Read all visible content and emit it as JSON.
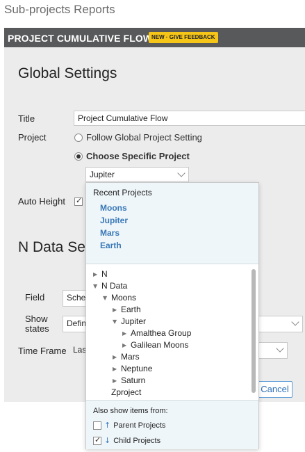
{
  "page": {
    "heading": "Sub-projects Reports"
  },
  "panel": {
    "title": "PROJECT CUMULATIVE FLOW",
    "badge": "NEW · GIVE FEEDBACK"
  },
  "global_settings": {
    "section_title": "Global Settings",
    "title_label": "Title",
    "title_value": "Project Cumulative Flow",
    "project_label": "Project",
    "radio_follow": "Follow Global Project Setting",
    "radio_choose": "Choose Specific Project",
    "selected_project": "Jupiter",
    "auto_height_label": "Auto Height",
    "auto_height_checked": true
  },
  "n_data": {
    "section_title": "N Data Set",
    "field_label": "Field",
    "field_value": "Sched",
    "show_states_label_line1": "Show",
    "show_states_label_line2": "states",
    "show_states_value": "Defin",
    "time_frame_label": "Time Frame",
    "time_frame_value": "Las"
  },
  "buttons": {
    "cancel": "Cancel"
  },
  "picker": {
    "recent_title": "Recent Projects",
    "recent": [
      "Moons",
      "Jupiter",
      "Mars",
      "Earth"
    ],
    "tree": [
      {
        "label": "N",
        "depth": 0,
        "state": "collapsed"
      },
      {
        "label": "N Data",
        "depth": 0,
        "state": "expanded"
      },
      {
        "label": "Moons",
        "depth": 1,
        "state": "expanded"
      },
      {
        "label": "Earth",
        "depth": 2,
        "state": "collapsed"
      },
      {
        "label": "Jupiter",
        "depth": 2,
        "state": "expanded"
      },
      {
        "label": "Amalthea Group",
        "depth": 3,
        "state": "collapsed"
      },
      {
        "label": "Galilean Moons",
        "depth": 3,
        "state": "collapsed"
      },
      {
        "label": "Mars",
        "depth": 2,
        "state": "collapsed"
      },
      {
        "label": "Neptune",
        "depth": 2,
        "state": "collapsed"
      },
      {
        "label": "Saturn",
        "depth": 2,
        "state": "collapsed"
      },
      {
        "label": "Zproject",
        "depth": 1,
        "state": "leaf"
      }
    ],
    "also_title": "Also show items from:",
    "parent_label": "Parent Projects",
    "parent_checked": false,
    "child_label": "Child Projects",
    "child_checked": true
  },
  "icons": {
    "parent": "arrow-up-icon",
    "child": "arrow-down-icon",
    "expand": "triangle-right-icon",
    "collapse": "triangle-down-icon"
  },
  "colors": {
    "header": "#58595b",
    "badge": "#f5c518",
    "link": "#3a78b8",
    "panel": "#ececec"
  }
}
